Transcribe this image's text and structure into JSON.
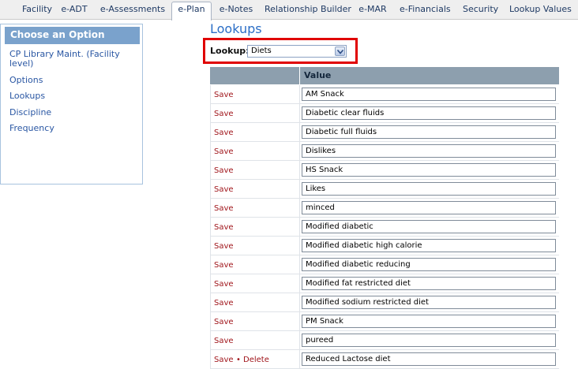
{
  "tabs": [
    {
      "label": "Facility",
      "name": "tab-facility"
    },
    {
      "label": "e-ADT",
      "name": "tab-e-adt"
    },
    {
      "label": "e-Assessments",
      "name": "tab-e-assessments"
    },
    {
      "label": "e-Plan",
      "name": "tab-e-plan",
      "active": true
    },
    {
      "label": "e-Notes",
      "name": "tab-e-notes"
    },
    {
      "label": "Relationship Builder",
      "name": "tab-relationship-builder"
    },
    {
      "label": "e-MAR",
      "name": "tab-e-mar"
    },
    {
      "label": "e-Financials",
      "name": "tab-e-financials"
    },
    {
      "label": "Security",
      "name": "tab-security"
    },
    {
      "label": "Lookup Values",
      "name": "tab-lookup-values"
    }
  ],
  "sidebar": {
    "header": "Choose an Option",
    "items": [
      {
        "label": "CP Library Maint. (Facility level)"
      },
      {
        "label": "Options"
      },
      {
        "label": "Lookups"
      },
      {
        "label": "Discipline"
      },
      {
        "label": "Frequency"
      }
    ]
  },
  "main": {
    "title": "Lookups",
    "lookup_label": "Lookup:",
    "lookup_selected": "Diets",
    "highlight_color": "#e00000",
    "columns": [
      "",
      "Value"
    ],
    "save_label": "Save",
    "delete_label": "Delete",
    "bullet": "•",
    "rows": [
      {
        "value": "AM Snack"
      },
      {
        "value": "Diabetic clear fluids"
      },
      {
        "value": "Diabetic full fluids"
      },
      {
        "value": "Dislikes"
      },
      {
        "value": "HS Snack"
      },
      {
        "value": "Likes"
      },
      {
        "value": "minced"
      },
      {
        "value": "Modified diabetic"
      },
      {
        "value": "Modified diabetic high calorie"
      },
      {
        "value": "Modified diabetic reducing"
      },
      {
        "value": "Modified fat restricted diet"
      },
      {
        "value": "Modified sodium restricted diet"
      },
      {
        "value": "PM Snack"
      },
      {
        "value": "pureed"
      },
      {
        "value": "Reduced Lactose diet",
        "deletable": true
      }
    ]
  },
  "icons": {
    "dropdown": "chevron-down-icon"
  }
}
